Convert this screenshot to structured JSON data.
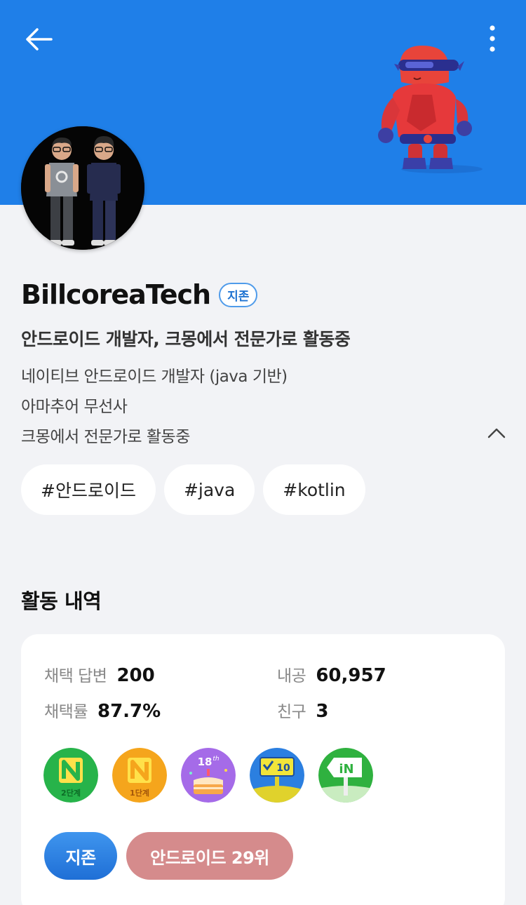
{
  "profile": {
    "name": "BillcoreaTech",
    "badge": "지존",
    "headline": "안드로이드 개발자, 크몽에서 전문가로 활동중",
    "bio": [
      "네이티브 안드로이드 개발자 (java 기반)",
      "아마추어 무선사",
      "크몽에서 전문가로 활동중"
    ],
    "tags": [
      "#안드로이드",
      "#java",
      "#kotlin"
    ]
  },
  "activity": {
    "title": "활동 내역",
    "stats": {
      "adopted_answers_label": "채택 답변",
      "adopted_answers_value": "200",
      "inner_power_label": "내공",
      "inner_power_value": "60,957",
      "adoption_rate_label": "채택률",
      "adoption_rate_value": "87.7%",
      "friends_label": "친구",
      "friends_value": "3"
    },
    "medal_texts": {
      "level2": "2단계",
      "level1": "1단계",
      "anniversary": "18",
      "anniversary_sup": "th",
      "checkin": "10",
      "in_sign": "iN"
    },
    "rank_pills": {
      "zone": "지존",
      "rank": "안드로이드 29위"
    }
  },
  "colors": {
    "header_blue": "#1f7fe8",
    "page_bg": "#f2f3f6",
    "zone_pill": "#1f6fd6",
    "rank_pill": "#d58b8c"
  }
}
